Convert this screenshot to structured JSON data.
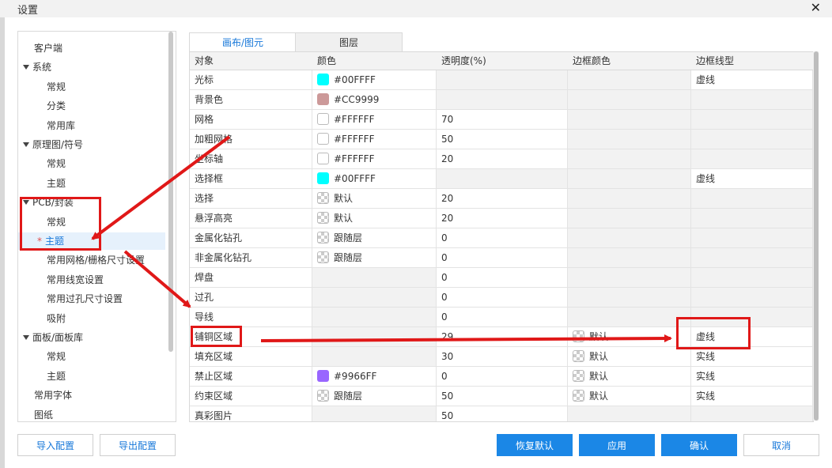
{
  "window": {
    "title": "设置"
  },
  "sidebar": {
    "items": [
      {
        "label": "客户端",
        "level": 0,
        "expandable": false,
        "selected": false
      },
      {
        "label": "系统",
        "level": 0,
        "expandable": true,
        "selected": false
      },
      {
        "label": "常规",
        "level": 1,
        "expandable": false,
        "selected": false
      },
      {
        "label": "分类",
        "level": 1,
        "expandable": false,
        "selected": false
      },
      {
        "label": "常用库",
        "level": 1,
        "expandable": false,
        "selected": false
      },
      {
        "label": "原理图/符号",
        "level": 0,
        "expandable": true,
        "selected": false
      },
      {
        "label": "常规",
        "level": 1,
        "expandable": false,
        "selected": false
      },
      {
        "label": "主题",
        "level": 1,
        "expandable": false,
        "selected": false
      },
      {
        "label": "PCB/封装",
        "level": 0,
        "expandable": true,
        "selected": false
      },
      {
        "label": "常规",
        "level": 1,
        "expandable": false,
        "selected": false
      },
      {
        "label": "主题",
        "level": 1,
        "expandable": false,
        "selected": true
      },
      {
        "label": "常用网格/栅格尺寸设置",
        "level": 1,
        "expandable": false,
        "selected": false
      },
      {
        "label": "常用线宽设置",
        "level": 1,
        "expandable": false,
        "selected": false
      },
      {
        "label": "常用过孔尺寸设置",
        "level": 1,
        "expandable": false,
        "selected": false
      },
      {
        "label": "吸附",
        "level": 1,
        "expandable": false,
        "selected": false
      },
      {
        "label": "面板/面板库",
        "level": 0,
        "expandable": true,
        "selected": false
      },
      {
        "label": "常规",
        "level": 1,
        "expandable": false,
        "selected": false
      },
      {
        "label": "主题",
        "level": 1,
        "expandable": false,
        "selected": false
      },
      {
        "label": "常用字体",
        "level": 0,
        "expandable": false,
        "selected": false
      },
      {
        "label": "图纸",
        "level": 0,
        "expandable": false,
        "selected": false
      }
    ],
    "selected_marker": "*"
  },
  "tabs": [
    {
      "label": "画布/图元",
      "active": true
    },
    {
      "label": "图层",
      "active": false
    }
  ],
  "table": {
    "columns": [
      "对象",
      "颜色",
      "透明度(%)",
      "边框颜色",
      "边框线型"
    ],
    "rows": [
      {
        "object": "光标",
        "color": "#00FFFF",
        "color_swatch": "#00FFFF",
        "opacity": "",
        "border_color": "",
        "border_color_swatch": "",
        "border_style": "虚线"
      },
      {
        "object": "背景色",
        "color": "#CC9999",
        "color_swatch": "#CC9999",
        "opacity": "",
        "border_color": "",
        "border_color_swatch": "",
        "border_style": ""
      },
      {
        "object": "网格",
        "color": "#FFFFFF",
        "color_swatch": "#FFFFFF",
        "opacity": "70",
        "border_color": "",
        "border_color_swatch": "",
        "border_style": ""
      },
      {
        "object": "加粗网格",
        "color": "#FFFFFF",
        "color_swatch": "#FFFFFF",
        "opacity": "50",
        "border_color": "",
        "border_color_swatch": "",
        "border_style": ""
      },
      {
        "object": "坐标轴",
        "color": "#FFFFFF",
        "color_swatch": "#FFFFFF",
        "opacity": "20",
        "border_color": "",
        "border_color_swatch": "",
        "border_style": ""
      },
      {
        "object": "选择框",
        "color": "#00FFFF",
        "color_swatch": "#00FFFF",
        "opacity": "",
        "border_color": "",
        "border_color_swatch": "",
        "border_style": "虚线"
      },
      {
        "object": "选择",
        "color": "默认",
        "color_swatch": "checker",
        "opacity": "20",
        "border_color": "",
        "border_color_swatch": "",
        "border_style": ""
      },
      {
        "object": "悬浮高亮",
        "color": "默认",
        "color_swatch": "checker",
        "opacity": "20",
        "border_color": "",
        "border_color_swatch": "",
        "border_style": ""
      },
      {
        "object": "金属化钻孔",
        "color": "跟随层",
        "color_swatch": "checker",
        "opacity": "0",
        "border_color": "",
        "border_color_swatch": "",
        "border_style": ""
      },
      {
        "object": "非金属化钻孔",
        "color": "跟随层",
        "color_swatch": "checker",
        "opacity": "0",
        "border_color": "",
        "border_color_swatch": "",
        "border_style": ""
      },
      {
        "object": "焊盘",
        "color": "",
        "color_swatch": "",
        "opacity": "0",
        "border_color": "",
        "border_color_swatch": "",
        "border_style": ""
      },
      {
        "object": "过孔",
        "color": "",
        "color_swatch": "",
        "opacity": "0",
        "border_color": "",
        "border_color_swatch": "",
        "border_style": ""
      },
      {
        "object": "导线",
        "color": "",
        "color_swatch": "",
        "opacity": "0",
        "border_color": "",
        "border_color_swatch": "",
        "border_style": ""
      },
      {
        "object": "铺铜区域",
        "color": "",
        "color_swatch": "",
        "opacity": "29",
        "border_color": "默认",
        "border_color_swatch": "checker",
        "border_style": "虚线"
      },
      {
        "object": "填充区域",
        "color": "",
        "color_swatch": "",
        "opacity": "30",
        "border_color": "默认",
        "border_color_swatch": "checker",
        "border_style": "实线"
      },
      {
        "object": "禁止区域",
        "color": "#9966FF",
        "color_swatch": "#9966FF",
        "opacity": "0",
        "border_color": "默认",
        "border_color_swatch": "checker",
        "border_style": "实线"
      },
      {
        "object": "约束区域",
        "color": "跟随层",
        "color_swatch": "checker",
        "opacity": "50",
        "border_color": "默认",
        "border_color_swatch": "checker",
        "border_style": "实线"
      },
      {
        "object": "真彩图片",
        "color": "",
        "color_swatch": "",
        "opacity": "50",
        "border_color": "",
        "border_color_swatch": "",
        "border_style": ""
      }
    ]
  },
  "buttons": {
    "import": "导入配置",
    "export": "导出配置",
    "restore": "恢复默认",
    "apply": "应用",
    "ok": "确认",
    "cancel": "取消"
  },
  "colors": {
    "accent": "#1B87E6",
    "annotation": "#E01818",
    "selected_bg": "#E6F1FC"
  }
}
